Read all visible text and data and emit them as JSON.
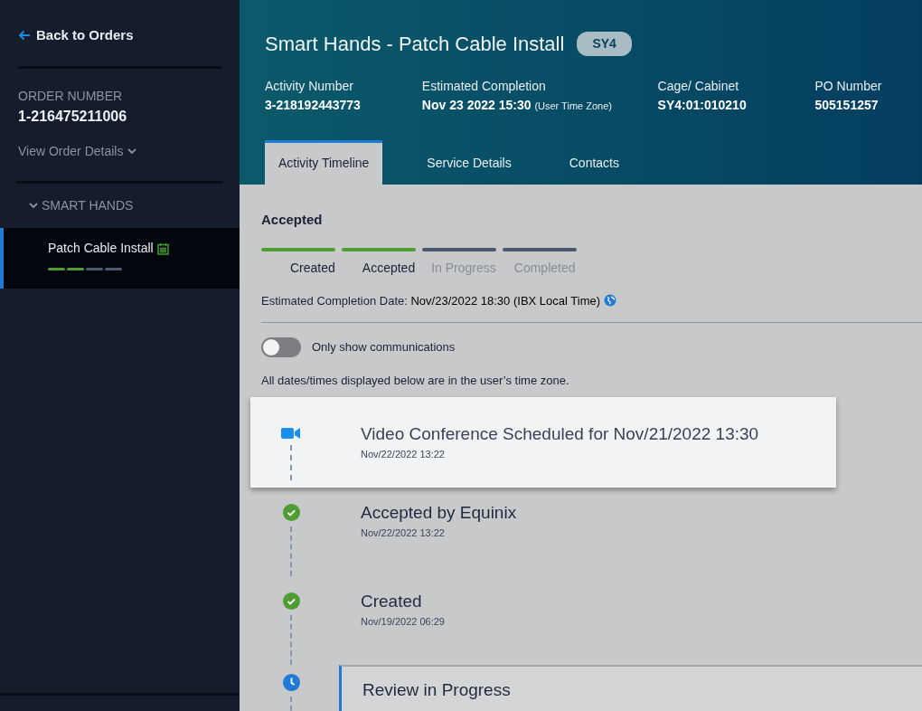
{
  "sidebar": {
    "back_link": "Back to Orders",
    "order_number_label": "ORDER NUMBER",
    "order_number": "1-216475211006",
    "view_details": "View Order Details",
    "section": {
      "label": "SMART HANDS",
      "expanded": true
    },
    "items": [
      {
        "label": "Patch Cable Install",
        "selected": true,
        "progress": [
          {
            "done": true
          },
          {
            "done": true
          },
          {
            "done": false
          },
          {
            "done": false
          }
        ]
      }
    ]
  },
  "header": {
    "title": "Smart Hands - Patch Cable Install",
    "badge": "SY4",
    "fields": [
      {
        "label": "Activity Number",
        "value": "3-218192443773"
      },
      {
        "label": "Estimated Completion",
        "value": "Nov 23 2022 15:30",
        "note": "(User Time Zone)"
      },
      {
        "label": "Cage/ Cabinet",
        "value": "SY4:01:010210"
      },
      {
        "label": "PO Number",
        "value": "505151257"
      }
    ]
  },
  "tabs": [
    {
      "label": "Activity Timeline",
      "selected": true
    },
    {
      "label": "Service Details",
      "selected": false
    },
    {
      "label": "Contacts",
      "selected": false
    }
  ],
  "status": {
    "title": "Accepted",
    "steps": [
      {
        "label": "Created",
        "done": true
      },
      {
        "label": "Accepted",
        "done": true
      },
      {
        "label": "In Progress",
        "done": false
      },
      {
        "label": "Completed",
        "done": false
      }
    ],
    "estimate_label": "Estimated Completion Date:",
    "estimate_value": "Nov/23/2022 18:30 (IBX Local Time)"
  },
  "toggle": {
    "label": "Only show communications",
    "on": false
  },
  "note": "All dates/times displayed below are in the user’s time zone.",
  "events": [
    {
      "kind": "video",
      "title": "Video Conference Scheduled for Nov/21/2022 13:30",
      "time": "Nov/22/2022 13:22"
    },
    {
      "kind": "done",
      "title": "Accepted by Equinix",
      "time": "Nov/22/2022 13:22"
    },
    {
      "kind": "done",
      "title": "Created",
      "time": "Nov/19/2022 06:29"
    },
    {
      "kind": "pending",
      "title": "Review in Progress"
    }
  ]
}
